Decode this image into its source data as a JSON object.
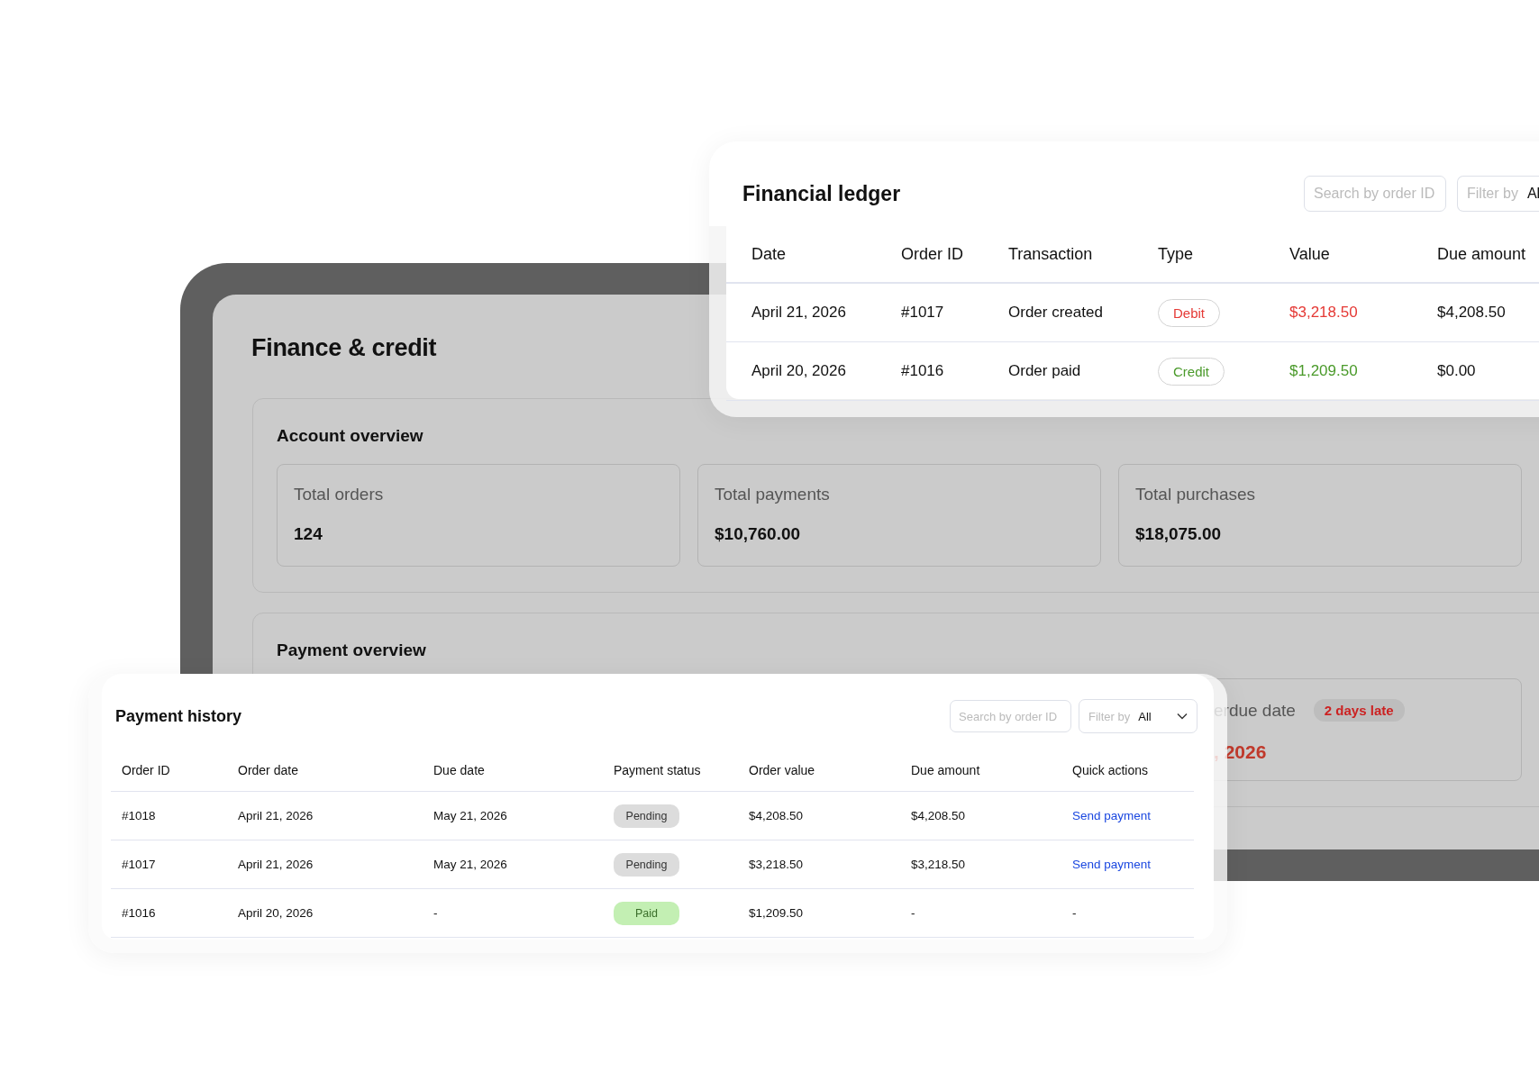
{
  "finance": {
    "title": "Finance & credit",
    "account_overview": {
      "title": "Account overview",
      "cards": [
        {
          "label": "Total orders",
          "value": "124"
        },
        {
          "label": "Total payments",
          "value": "$10,760.00"
        },
        {
          "label": "Total purchases",
          "value": "$18,075.00"
        }
      ]
    },
    "payment_overview": {
      "title": "Payment overview",
      "cards": [
        {
          "label": "erdue date",
          "badge": "2 days late",
          "value": ", 2026"
        }
      ]
    }
  },
  "ledger": {
    "title": "Financial ledger",
    "search": {
      "placeholder": "Search by order ID"
    },
    "filter": {
      "label": "Filter by",
      "value": "Al"
    },
    "columns": [
      "Date",
      "Order ID",
      "Transaction",
      "Type",
      "Value",
      "Due amount"
    ],
    "rows": [
      {
        "date": "April 21, 2026",
        "order_id": "#1017",
        "transaction": "Order created",
        "type": {
          "label": "Debit",
          "kind": "debit"
        },
        "value": "$3,218.50",
        "due_amount": "$4,208.50"
      },
      {
        "date": "April 20, 2026",
        "order_id": "#1016",
        "transaction": "Order paid",
        "type": {
          "label": "Credit",
          "kind": "credit"
        },
        "value": "$1,209.50",
        "due_amount": "$0.00"
      }
    ]
  },
  "payment_history": {
    "title": "Payment history",
    "search": {
      "placeholder": "Search by order ID"
    },
    "filter": {
      "label": "Filter by",
      "value": "All"
    },
    "columns": [
      "Order ID",
      "Order date",
      "Due date",
      "Payment status",
      "Order value",
      "Due amount",
      "Quick actions"
    ],
    "rows": [
      {
        "order_id": "#1018",
        "order_date": "April 21, 2026",
        "due_date": "May 21, 2026",
        "status": {
          "label": "Pending",
          "kind": "pending"
        },
        "order_value": "$4,208.50",
        "due_amount": "$4,208.50",
        "action": {
          "label": "Send payment",
          "kind": "link"
        }
      },
      {
        "order_id": "#1017",
        "order_date": "April 21, 2026",
        "due_date": "May 21, 2026",
        "status": {
          "label": "Pending",
          "kind": "pending"
        },
        "order_value": "$3,218.50",
        "due_amount": "$3,218.50",
        "action": {
          "label": "Send payment",
          "kind": "link"
        }
      },
      {
        "order_id": "#1016",
        "order_date": "April 20, 2026",
        "due_date": "-",
        "status": {
          "label": "Paid",
          "kind": "paid"
        },
        "order_value": "$1,209.50",
        "due_amount": "-",
        "action": {
          "label": "-",
          "kind": "none"
        }
      }
    ]
  }
}
